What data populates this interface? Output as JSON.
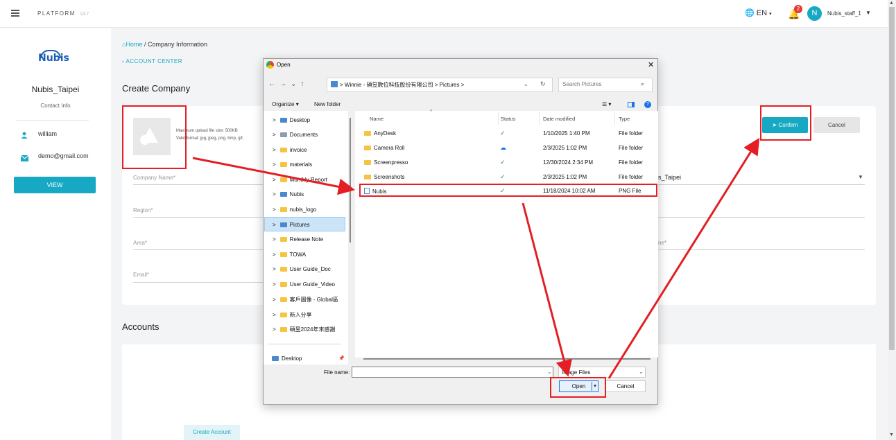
{
  "topbar": {
    "platform": "PLATFORM",
    "version": "V3.7",
    "language": "EN",
    "notification_count": "2",
    "avatar_letter": "N",
    "user": "Nubis_staff_1"
  },
  "sidebar": {
    "logo": "Nubis",
    "name": "Nubis_Taipei",
    "contact_label": "Contact Info",
    "contact_name": "william",
    "contact_email": "demo@gmail.com",
    "view_button": "VIEW"
  },
  "main": {
    "breadcrumb_home": "Home",
    "breadcrumb_sep": "/",
    "breadcrumb_current": "Company Information",
    "back_label": "ACCOUNT CENTER",
    "title": "Create Company",
    "upload_max": "Maximum upload file size: 500KB",
    "upload_format": "Valid format: jpg, jpeg, png, bmp, gif,",
    "fields": {
      "company_name": "Company Name*",
      "region": "Region*",
      "area": "Area*",
      "email": "Email*",
      "right_value": "s_Taipei",
      "right_label": "ne*"
    },
    "confirm": "Confirm",
    "cancel": "Cancel",
    "accounts_title": "Accounts",
    "create_account": "Create Account"
  },
  "dialog": {
    "title": "Open",
    "address": {
      "sep": ">",
      "segment1": "Winnie - 碩昱數位科技股份有限公司",
      "segment2": "Pictures"
    },
    "search_placeholder": "Search Pictures",
    "organize": "Organize",
    "new_folder": "New folder",
    "nav_items": [
      "Desktop",
      "Documents",
      "invoice",
      "materials",
      "Monthly Report",
      "Nubis",
      "nubis_logo",
      "Pictures",
      "Release Note",
      "TOWA",
      "User Guide_Doc",
      "User Guide_Video",
      "客戶圖像 - Global區",
      "新人分享",
      "碩昱2024年末感謝",
      "Desktop"
    ],
    "columns": {
      "name": "Name",
      "status": "Status",
      "modified": "Date modified",
      "type": "Type"
    },
    "files": [
      {
        "name": "AnyDesk",
        "status": "✓",
        "modified": "1/10/2025 1:40 PM",
        "type": "File folder"
      },
      {
        "name": "Camera Roll",
        "status": "☁",
        "modified": "2/3/2025 1:02 PM",
        "type": "File folder"
      },
      {
        "name": "Screenpresso",
        "status": "✓",
        "modified": "12/30/2024 2:34 PM",
        "type": "File folder"
      },
      {
        "name": "Screenshots",
        "status": "✓",
        "modified": "2/3/2025 1:02 PM",
        "type": "File folder"
      },
      {
        "name": "Nubis",
        "status": "✓",
        "modified": "11/18/2024 10:02 AM",
        "type": "PNG File"
      }
    ],
    "filename_label": "File name:",
    "filename_value": "",
    "filetype": "Image Files",
    "open_button": "Open",
    "cancel_button": "Cancel"
  },
  "colors": {
    "accent": "#17a8c3",
    "annotation": "#e31e24"
  }
}
